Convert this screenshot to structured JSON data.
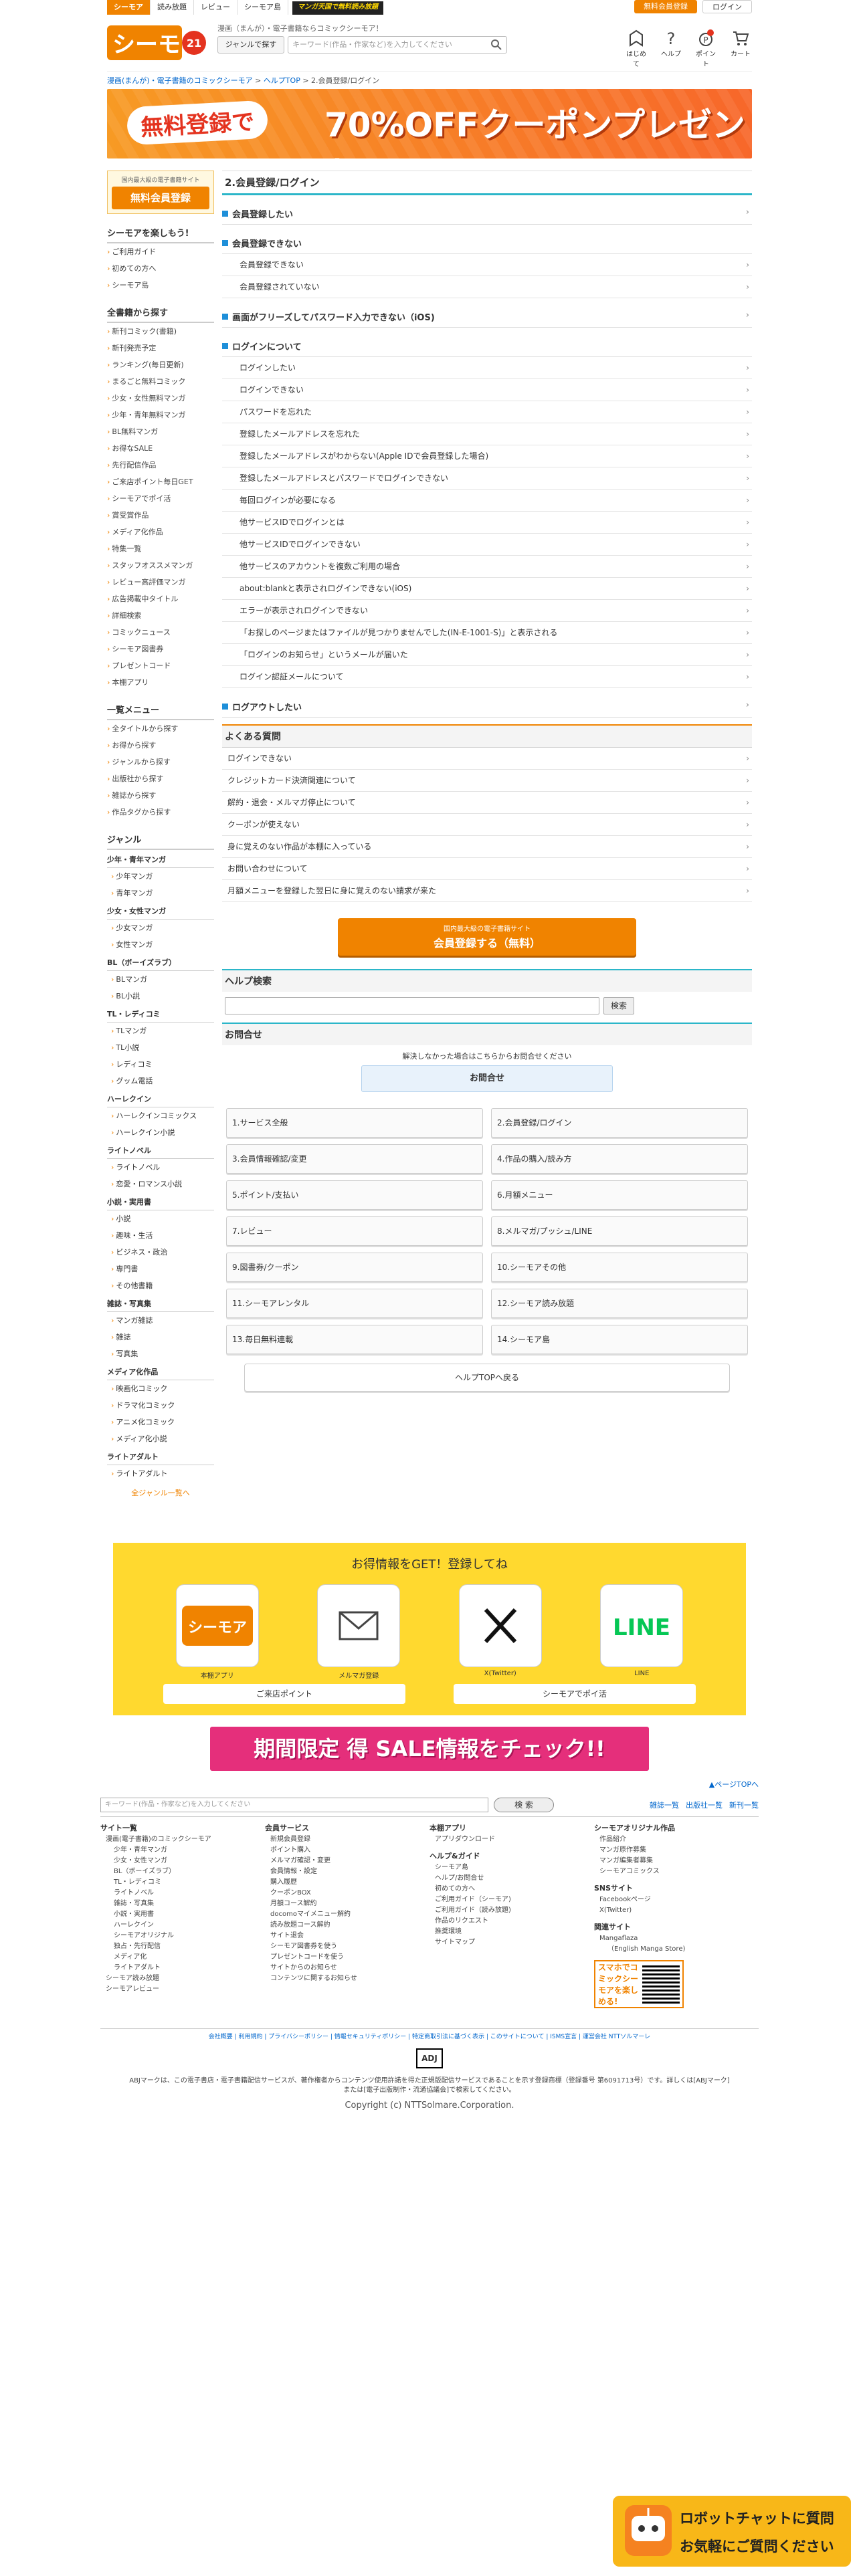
{
  "topnav": {
    "tabs": [
      "シーモア",
      "読み放題",
      "レビュー",
      "シーモア島"
    ],
    "banner": "マンガ天国で無料読み放題",
    "register": "無料会員登録",
    "login": "ログイン"
  },
  "header": {
    "logo_text": "コミックシーモア",
    "tagline": "漫画（まんが）・電子書籍ならコミックシーモア！",
    "genre_button": "ジャンルで探す",
    "search_placeholder": "キーワード(作品・作家など)を入力してください",
    "icons": [
      {
        "label": "はじめて",
        "icon": "beginner-icon"
      },
      {
        "label": "ヘルプ",
        "icon": "help-icon"
      },
      {
        "label": "ポイント",
        "icon": "point-icon"
      },
      {
        "label": "カート",
        "icon": "cart-icon"
      }
    ],
    "point_badge": "",
    "points_label": "P"
  },
  "breadcrumb": {
    "home": "漫画(まんが)・電子書籍のコミックシーモア",
    "sep": ">",
    "help": "ヘルプTOP",
    "current": "2.会員登録/ログイン"
  },
  "hero": {
    "pill": "無料登録で",
    "big": "70%OFFクーポンプレゼント!"
  },
  "sidebar": {
    "cta_small": "国内最大級の電子書籍サイト",
    "cta_button": "無料会員登録",
    "enjoy_title": "シーモアを楽しもう!",
    "enjoy": [
      "ご利用ガイド",
      "初めての方へ",
      "シーモア島"
    ],
    "all_title": "全書籍から探す",
    "all": [
      "新刊コミック(書籍)",
      "新刊発売予定",
      "ランキング(毎日更新)",
      "まるごと無料コミック",
      "少女・女性無料マンガ",
      "少年・青年無料マンガ",
      "BL無料マンガ",
      "お得なSALE",
      "先行配信作品",
      "ご来店ポイント毎日GET",
      "シーモアでポイ活",
      "賞受賞作品",
      "メディア化作品",
      "特集一覧",
      "スタッフオススメマンガ",
      "レビュー高評価マンガ",
      "広告掲載中タイトル",
      "詳細検索",
      "コミックニュース",
      "シーモア図書券",
      "プレゼントコード",
      "本棚アプリ"
    ],
    "menu_title": "一覧メニュー",
    "menu": [
      "全タイトルから探す",
      "お得から探す",
      "ジャンルから探す",
      "出版社から探す",
      "雑誌から探す",
      "作品タグから探す"
    ],
    "genre_title": "ジャンル",
    "genres": [
      {
        "head": "少年・青年マンガ",
        "items": [
          "少年マンガ",
          "青年マンガ"
        ]
      },
      {
        "head": "少女・女性マンガ",
        "items": [
          "少女マンガ",
          "女性マンガ"
        ]
      },
      {
        "head": "BL（ボーイズラブ）",
        "items": [
          "BLマンガ",
          "BL小説"
        ]
      },
      {
        "head": "TL・レディコミ",
        "items": [
          "TLマンガ",
          "TL小説",
          "レディコミ",
          "グッム電話"
        ]
      },
      {
        "head": "ハーレクイン",
        "items": [
          "ハーレクインコミックス",
          "ハーレクイン小説"
        ]
      },
      {
        "head": "ライトノベル",
        "items": [
          "ライトノベル",
          "恋愛・ロマンス小説"
        ]
      },
      {
        "head": "小説・実用書",
        "items": [
          "小説",
          "趣味・生活",
          "ビジネス・政治",
          "専門書",
          "その他書籍"
        ]
      },
      {
        "head": "雑誌・写真集",
        "items": [
          "マンガ雑誌",
          "雑誌",
          "写真集"
        ]
      },
      {
        "head": "メディア化作品",
        "items": [
          "映画化コミック",
          "ドラマ化コミック",
          "アニメ化コミック",
          "メディア化小説"
        ]
      },
      {
        "head": "ライトアダルト",
        "items": [
          "ライトアダルト"
        ]
      }
    ],
    "all_genres": "全ジャンル一覧へ"
  },
  "main": {
    "title": "2.会員登録/ログイン",
    "sections": [
      {
        "title": "会員登録したい",
        "items": []
      },
      {
        "title": "会員登録できない",
        "items": [
          "会員登録できない",
          "会員登録されていない"
        ]
      },
      {
        "title": "画面がフリーズしてパスワード入力できない（iOS)",
        "items": []
      },
      {
        "title": "ログインについて",
        "items": [
          "ログインしたい",
          "ログインできない",
          "パスワードを忘れた",
          "登録したメールアドレスを忘れた",
          "登録したメールアドレスがわからない(Apple IDで会員登録した場合)",
          "登録したメールアドレスとパスワードでログインできない",
          "毎回ログインが必要になる",
          "他サービスIDでログインとは",
          "他サービスIDでログインできない",
          "他サービスのアカウントを複数ご利用の場合",
          "about:blankと表示されログインできない(iOS)",
          "エラーが表示されログインできない",
          "「お探しのページまたはファイルが見つかりませんでした(IN-E-1001-S)」と表示される",
          "「ログインのお知らせ」というメールが届いた",
          "ログイン認証メールについて"
        ]
      },
      {
        "title": "ログアウトしたい",
        "items": []
      }
    ],
    "faq_title": "よくある質問",
    "faq": [
      "ログインできない",
      "クレジットカード決済関連について",
      "解約・退会・メルマガ停止について",
      "クーポンが使えない",
      "身に覚えのない作品が本棚に入っている",
      "お問い合わせについて",
      "月額メニューを登録した翌日に身に覚えのない請求が来た"
    ],
    "reg_small": "国内最大級の電子書籍サイト",
    "reg_big": "会員登録する（無料）",
    "help_search_title": "ヘルプ検索",
    "help_search_button": "検索",
    "contact_title": "お問合せ",
    "contact_text": "解決しなかった場合はこちらからお問合せください",
    "contact_button": "お問合せ",
    "categories": [
      "1.サービス全般",
      "2.会員登録/ログイン",
      "3.会員情報確認/変更",
      "4.作品の購入/読み方",
      "5.ポイント/支払い",
      "6.月額メニュー",
      "7.レビュー",
      "8.メルマガ/プッシュ/LINE",
      "9.図書券/クーポン",
      "10.シーモアその他",
      "11.シーモアレンタル",
      "12.シーモア読み放題",
      "13.毎日無料連載",
      "14.シーモア島"
    ],
    "back_button": "ヘルプTOPへ戻る"
  },
  "promo": {
    "title": "お得情報をGET！登録してね",
    "apps": [
      {
        "label": "本棚アプリ",
        "icon": "seamoa-app-icon"
      },
      {
        "label": "メルマガ登録",
        "icon": "mail-icon"
      },
      {
        "label": "X(Twitter)",
        "icon": "x-icon"
      },
      {
        "label": "LINE",
        "icon": "line-icon"
      }
    ],
    "app_texts": {
      "seamoa": "シーモア",
      "line": "LINE"
    },
    "btn_left": "ご来店ポイント",
    "btn_right": "シーモアでポイ活"
  },
  "sale_banner": "期間限定 得 SALE情報をチェック!!",
  "pagetop": "▲ページTOPへ",
  "footer": {
    "search_placeholder": "キーワード(作品・作家など)を入力してください",
    "search_button": "検 索",
    "links": [
      "雑誌一覧",
      "出版社一覧",
      "新刊一覧"
    ],
    "col1_title": "サイト一覧",
    "col1": [
      "漫画(電子書籍)のコミックシーモア",
      "少年・青年マンガ",
      "少女・女性マンガ",
      "BL（ボーイズラブ）",
      "TL・レディコミ",
      "ライトノベル",
      "雑誌・写真集",
      "小説・実用書",
      "ハーレクイン",
      "シーモアオリジナル",
      "独占・先行配信",
      "メディア化",
      "ライトアダルト",
      "シーモア読み放題",
      "シーモアレビュー"
    ],
    "col2_title": "会員サービス",
    "col2": [
      "新規会員登録",
      "ポイント購入",
      "メルマガ確認・変更",
      "会員情報・設定",
      "購入履歴",
      "クーポンBOX",
      "月額コース解約",
      "docomoマイメニュー解約",
      "読み放題コース解約",
      "サイト退会",
      "シーモア図書券を使う",
      "プレゼントコードを使う",
      "サイトからのお知らせ",
      "コンテンツに関するお知らせ"
    ],
    "col3_title": "本棚アプリ",
    "col3a": [
      "アプリダウンロード"
    ],
    "col3b_title": "ヘルプ&ガイド",
    "col3b": [
      "シーモア島",
      "ヘルプ/お問合せ",
      "初めての方へ",
      "ご利用ガイド（シーモア)",
      "ご利用ガイド（読み放題)",
      "作品のリクエスト",
      "推奨環境",
      "サイトマップ"
    ],
    "col4_title": "シーモアオリジナル作品",
    "col4": [
      "作品紹介",
      "マンガ原作募集",
      "マンガ編集者募集",
      "シーモアコミックス"
    ],
    "col4b_title": "SNSサイト",
    "col4b": [
      "Facebookページ",
      "X(Twitter)"
    ],
    "col4c_title": "関連サイト",
    "col4c": [
      "Mangaflaza",
      "（English Manga Store)"
    ],
    "qr_text": "スマホでコミックシーモアを楽しめる!",
    "legal_links": "会社概要 | 利用規約 | プライバシーポリシー | 情報セキュリティポリシー | 特定商取引法に基づく表示 | このサイトについて | ISMS宣言 | 運営会社 NTTソルマーレ",
    "adj": "ADJ",
    "legal_text": "ABJマークは、この電子書店・電子書籍配信サービスが、著作権者からコンテンツ使用許諾を得た正規版配信サービスであることを示す登録商標（登録番号 第6091713号）です。詳しくは[ABJマーク]または[電子出版制作・流通協議会]で検索してください。",
    "copyright": "Copyright (c) NTTSolmare.Corporation."
  },
  "robot": {
    "line1": "ロボットチャットに質問",
    "line2": "お気軽にご質問ください"
  },
  "colors": {
    "accent": "#f08300",
    "teal": "#2bb6c9",
    "blue": "#1e8fd9",
    "yellow": "#ffd92f",
    "pink": "#e52f7b"
  }
}
